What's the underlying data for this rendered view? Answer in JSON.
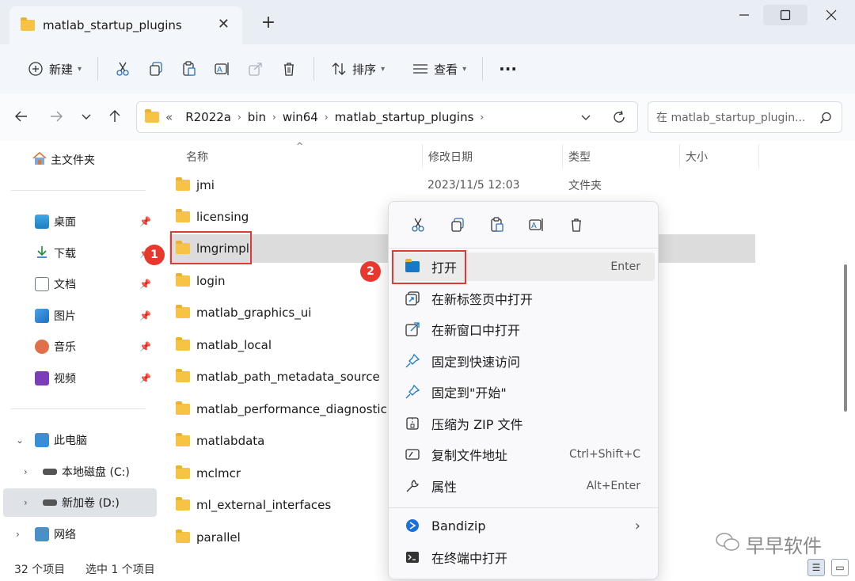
{
  "window": {
    "tab_title": "matlab_startup_plugins",
    "close_tab": "✕",
    "new_tab": "+"
  },
  "toolbar": {
    "new_label": "新建",
    "sort_label": "排序",
    "view_label": "查看",
    "more_label": "···"
  },
  "address": {
    "overflow": "«",
    "crumbs": [
      "R2022a",
      "bin",
      "win64",
      "matlab_startup_plugins"
    ],
    "search_placeholder": "在 matlab_startup_plugin..."
  },
  "sidebar": {
    "home": "主文件夹",
    "quick": [
      "桌面",
      "下载",
      "文档",
      "图片",
      "音乐",
      "视频"
    ],
    "pc": "此电脑",
    "drive_c": "本地磁盘 (C:)",
    "drive_d": "新加卷 (D:)",
    "network": "网络"
  },
  "columns": {
    "name": "名称",
    "date": "修改日期",
    "type": "类型",
    "size": "大小"
  },
  "files": [
    {
      "name": "jmi",
      "date": "2023/11/5 12:03",
      "type": "文件夹"
    },
    {
      "name": "licensing",
      "date": "",
      "type": ""
    },
    {
      "name": "lmgrimpl",
      "date": "",
      "type": ""
    },
    {
      "name": "login",
      "date": "",
      "type": ""
    },
    {
      "name": "matlab_graphics_ui",
      "date": "",
      "type": ""
    },
    {
      "name": "matlab_local",
      "date": "",
      "type": ""
    },
    {
      "name": "matlab_path_metadata_source",
      "date": "",
      "type": ""
    },
    {
      "name": "matlab_performance_diagnostic",
      "date": "",
      "type": ""
    },
    {
      "name": "matlabdata",
      "date": "",
      "type": ""
    },
    {
      "name": "mclmcr",
      "date": "",
      "type": ""
    },
    {
      "name": "ml_external_interfaces",
      "date": "",
      "type": ""
    },
    {
      "name": "parallel",
      "date": "",
      "type": ""
    }
  ],
  "status": {
    "count": "32 个项目",
    "selected": "选中 1 个项目"
  },
  "context_menu": {
    "items": [
      {
        "label": "打开",
        "key": "Enter"
      },
      {
        "label": "在新标签页中打开",
        "key": ""
      },
      {
        "label": "在新窗口中打开",
        "key": ""
      },
      {
        "label": "固定到快速访问",
        "key": ""
      },
      {
        "label": "固定到\"开始\"",
        "key": ""
      },
      {
        "label": "压缩为 ZIP 文件",
        "key": ""
      },
      {
        "label": "复制文件地址",
        "key": "Ctrl+Shift+C"
      },
      {
        "label": "属性",
        "key": "Alt+Enter"
      },
      {
        "label": "Bandizip",
        "key": ""
      },
      {
        "label": "在终端中打开",
        "key": ""
      }
    ]
  },
  "callouts": [
    "1",
    "2"
  ],
  "watermark": "早早软件",
  "colors": {
    "folder": "#f6c344",
    "callout": "#e8382e",
    "accent": "#0a67c4"
  }
}
